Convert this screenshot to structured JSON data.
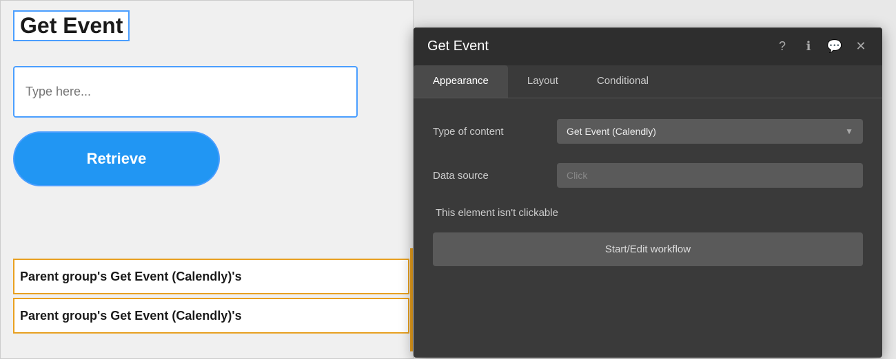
{
  "canvas": {
    "title": "Get Event",
    "input_placeholder": "Type here...",
    "retrieve_button": "Retrieve",
    "parent_row_1": "Parent group's Get Event (Calendly)'s",
    "parent_row_2": "Parent group's Get Event (Calendly)'s"
  },
  "panel": {
    "title": "Get Event",
    "icons": {
      "help": "?",
      "info": "ℹ",
      "chat": "💬",
      "close": "✕"
    },
    "tabs": [
      {
        "label": "Appearance",
        "active": true
      },
      {
        "label": "Layout",
        "active": false
      },
      {
        "label": "Conditional",
        "active": false
      }
    ],
    "form": {
      "type_of_content_label": "Type of content",
      "type_of_content_value": "Get Event (Calendly)",
      "data_source_label": "Data source",
      "data_source_placeholder": "Click",
      "not_clickable_label": "This element isn't clickable",
      "workflow_button": "Start/Edit workflow"
    }
  }
}
